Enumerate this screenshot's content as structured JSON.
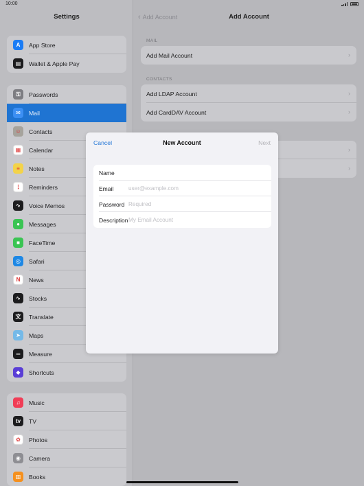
{
  "status": {
    "time": "10:00"
  },
  "sidebar": {
    "title": "Settings",
    "groups": [
      {
        "items": [
          {
            "label": "App Store",
            "icon": "app-store-icon",
            "color": "#1a7cf5",
            "glyph": "A"
          },
          {
            "label": "Wallet & Apple Pay",
            "icon": "wallet-icon",
            "color": "#1c1c1e",
            "glyph": "▤"
          }
        ]
      },
      {
        "items": [
          {
            "label": "Passwords",
            "icon": "key-icon",
            "color": "#7d7d82",
            "glyph": "⚿"
          },
          {
            "label": "Mail",
            "icon": "mail-icon",
            "color": "#3c8ff3",
            "glyph": "✉",
            "selected": true
          },
          {
            "label": "Contacts",
            "icon": "contacts-icon",
            "color": "#a6a39c",
            "glyph": "☺"
          },
          {
            "label": "Calendar",
            "icon": "calendar-icon",
            "color": "#ffffff",
            "glyph": "▦"
          },
          {
            "label": "Notes",
            "icon": "notes-icon",
            "color": "#f3d34a",
            "glyph": "≡"
          },
          {
            "label": "Reminders",
            "icon": "reminders-icon",
            "color": "#ffffff",
            "glyph": "⋮"
          },
          {
            "label": "Voice Memos",
            "icon": "voice-memos-icon",
            "color": "#1c1c1e",
            "glyph": "∿"
          },
          {
            "label": "Messages",
            "icon": "messages-icon",
            "color": "#3ac453",
            "glyph": "●"
          },
          {
            "label": "FaceTime",
            "icon": "facetime-icon",
            "color": "#3ac453",
            "glyph": "■"
          },
          {
            "label": "Safari",
            "icon": "safari-icon",
            "color": "#1e88e5",
            "glyph": "◎"
          },
          {
            "label": "News",
            "icon": "news-icon",
            "color": "#ffffff",
            "glyph": "N"
          },
          {
            "label": "Stocks",
            "icon": "stocks-icon",
            "color": "#1c1c1e",
            "glyph": "∿"
          },
          {
            "label": "Translate",
            "icon": "translate-icon",
            "color": "#1c1c1e",
            "glyph": "文"
          },
          {
            "label": "Maps",
            "icon": "maps-icon",
            "color": "#74b9e8",
            "glyph": "➤"
          },
          {
            "label": "Measure",
            "icon": "measure-icon",
            "color": "#1c1c1e",
            "glyph": "═"
          },
          {
            "label": "Shortcuts",
            "icon": "shortcuts-icon",
            "color": "#5a3ed6",
            "glyph": "◆"
          }
        ]
      },
      {
        "items": [
          {
            "label": "Music",
            "icon": "music-icon",
            "color": "#f03d56",
            "glyph": "♫"
          },
          {
            "label": "TV",
            "icon": "tv-icon",
            "color": "#1c1c1e",
            "glyph": "tv"
          },
          {
            "label": "Photos",
            "icon": "photos-icon",
            "color": "#ffffff",
            "glyph": "✿"
          },
          {
            "label": "Camera",
            "icon": "camera-icon",
            "color": "#8e8e93",
            "glyph": "◉"
          },
          {
            "label": "Books",
            "icon": "books-icon",
            "color": "#f5901e",
            "glyph": "▥"
          }
        ]
      }
    ]
  },
  "detail": {
    "back_label": "Add Account",
    "title": "Add Account",
    "mail_header": "MAIL",
    "mail_items": [
      "Add Mail Account"
    ],
    "contacts_header": "CONTACTS",
    "contacts_items": [
      "Add LDAP Account",
      "Add CardDAV Account"
    ]
  },
  "modal": {
    "cancel": "Cancel",
    "title": "New Account",
    "next": "Next",
    "fields": [
      {
        "label": "Name",
        "value": "",
        "placeholder": ""
      },
      {
        "label": "Email",
        "value": "",
        "placeholder": "user@example.com"
      },
      {
        "label": "Password",
        "value": "",
        "placeholder": "Required"
      },
      {
        "label": "Description",
        "value": "",
        "placeholder": "My Email Account"
      }
    ]
  }
}
